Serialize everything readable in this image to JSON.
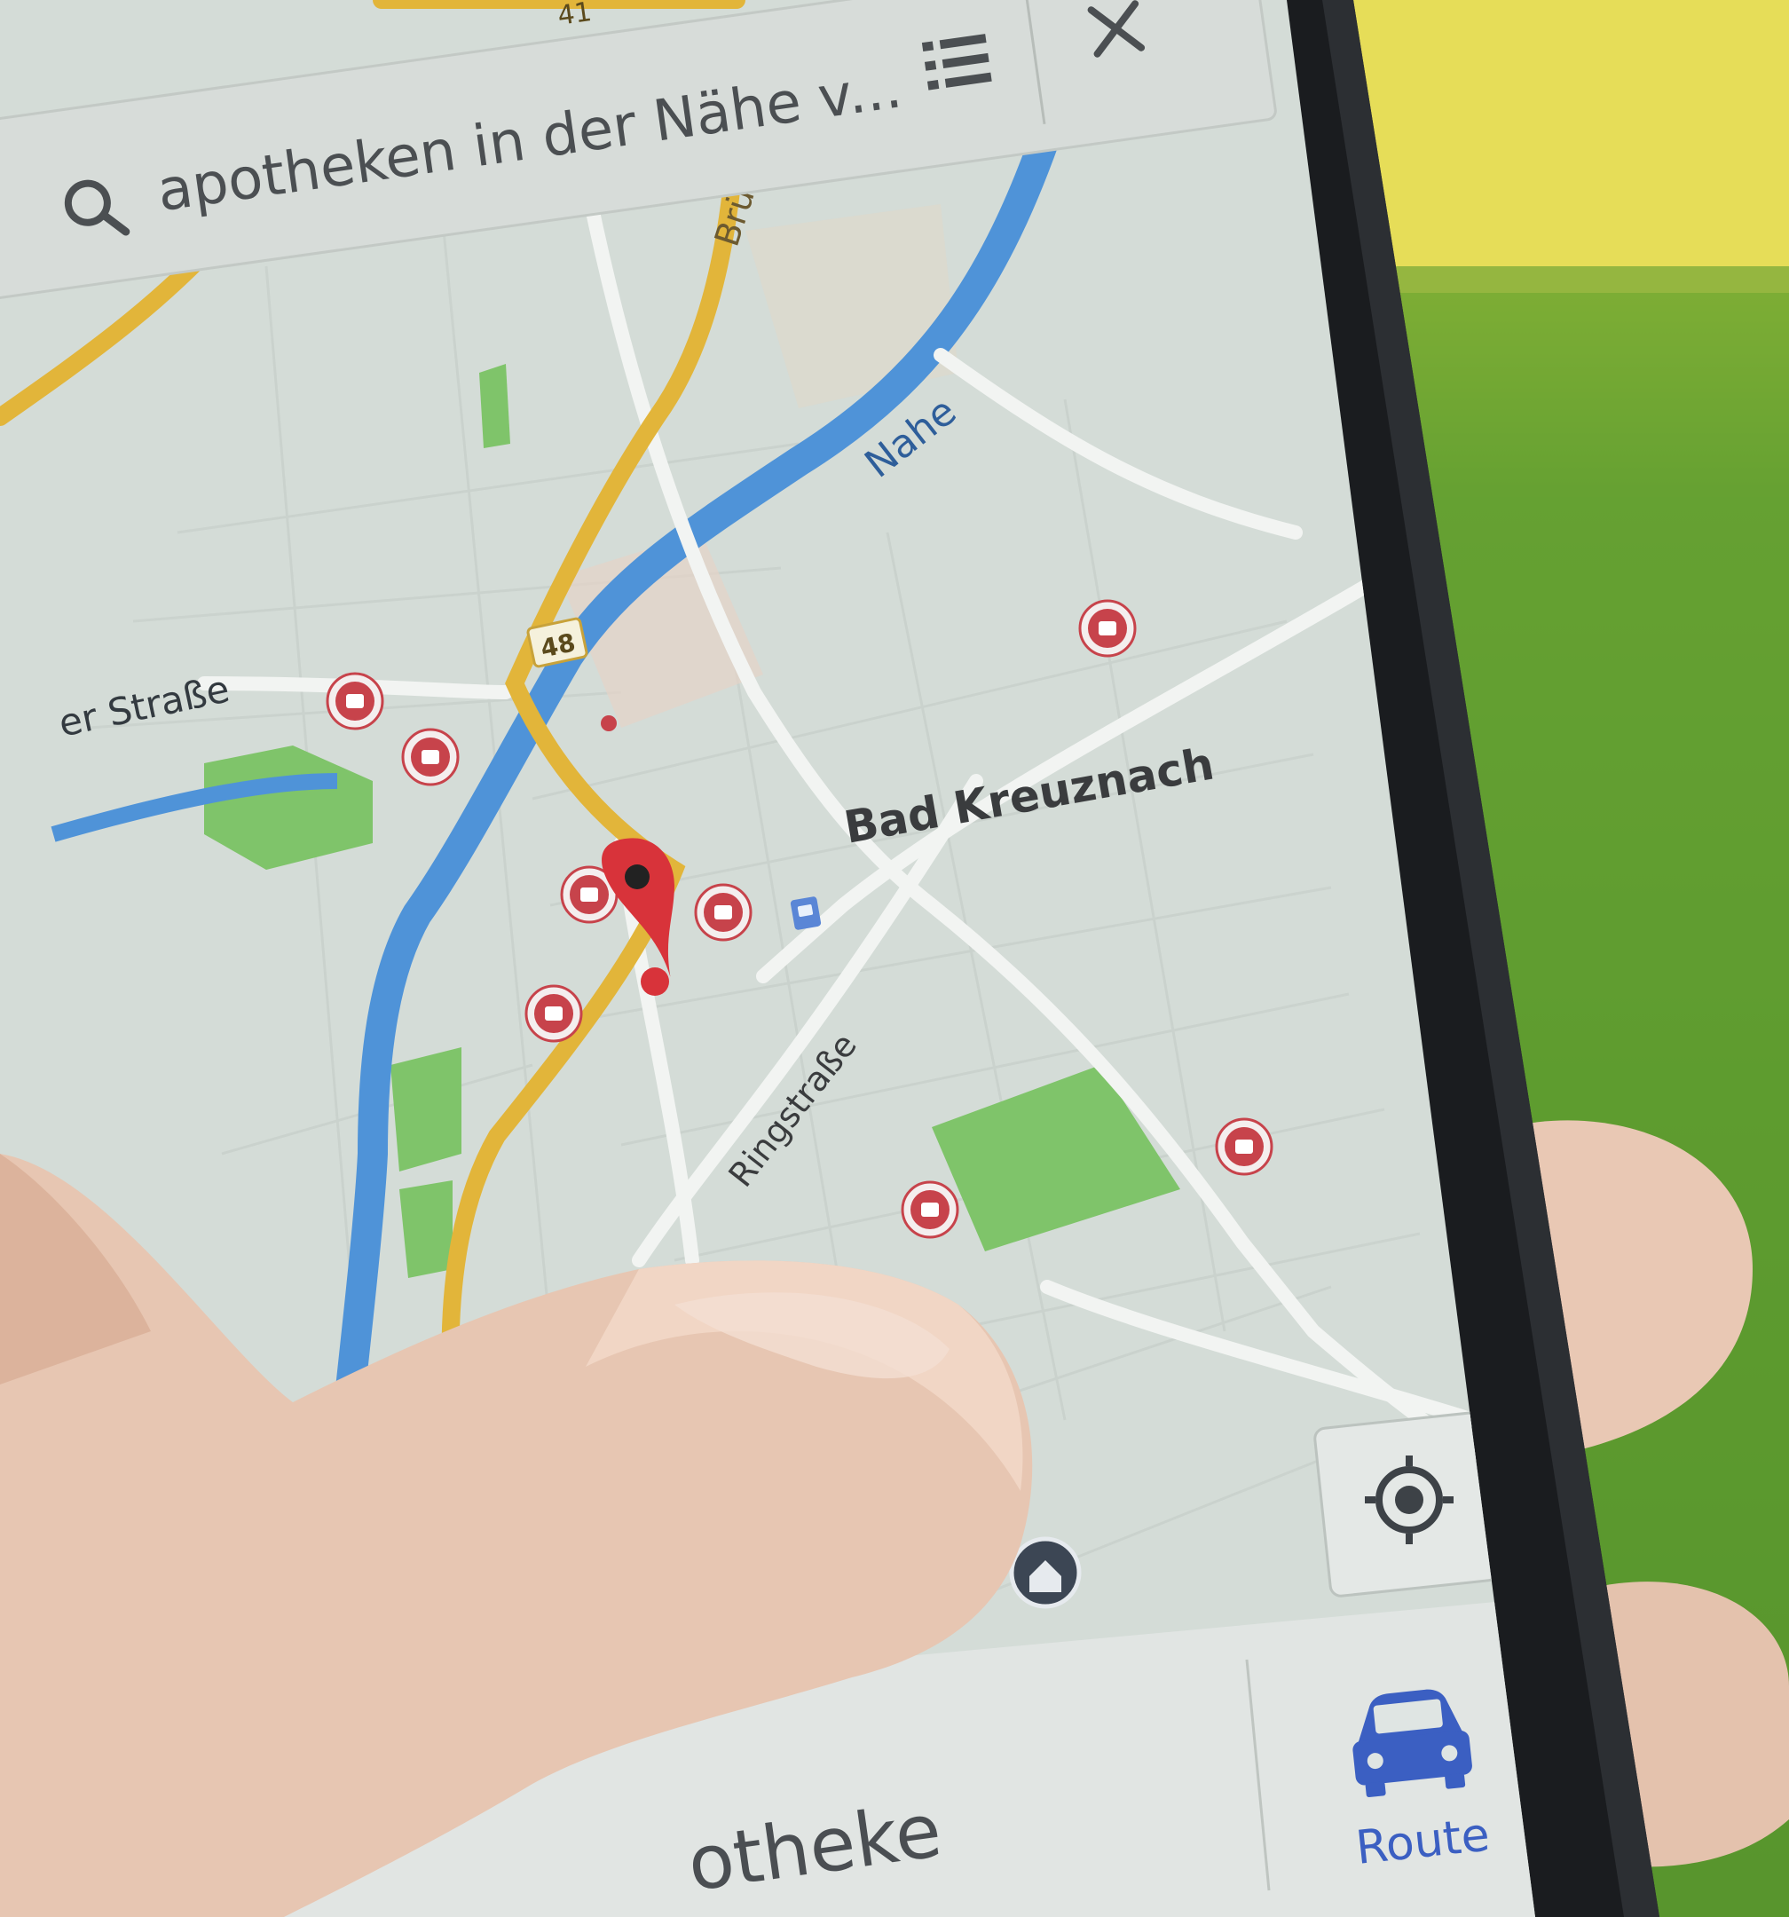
{
  "search": {
    "query": "apotheken in der Nähe v..."
  },
  "map": {
    "labels": {
      "street_left": "er Straße",
      "bruecke": "Brücke",
      "river": "Nahe",
      "road_48": "48",
      "road_41": "41",
      "city": "Bad Kreuznach",
      "ringstrasse": "Ringstraße"
    }
  },
  "bottom_bar": {
    "place_name": "otheke",
    "route_label": "Route"
  },
  "icons": {
    "search": "search-icon",
    "list": "list-icon",
    "close": "close-icon",
    "locate": "my-location-icon",
    "route": "car-icon",
    "pin": "map-pin-icon",
    "pharmacy": "pharmacy-marker-icon",
    "transit": "transit-icon",
    "home": "home-icon"
  },
  "colors": {
    "river": "#4f93d8",
    "highway": "#e2b53a",
    "park": "#7fc46a",
    "pin": "#d8333a",
    "route_blue": "#3b5fc2",
    "map_bg": "#d4dcd7"
  }
}
